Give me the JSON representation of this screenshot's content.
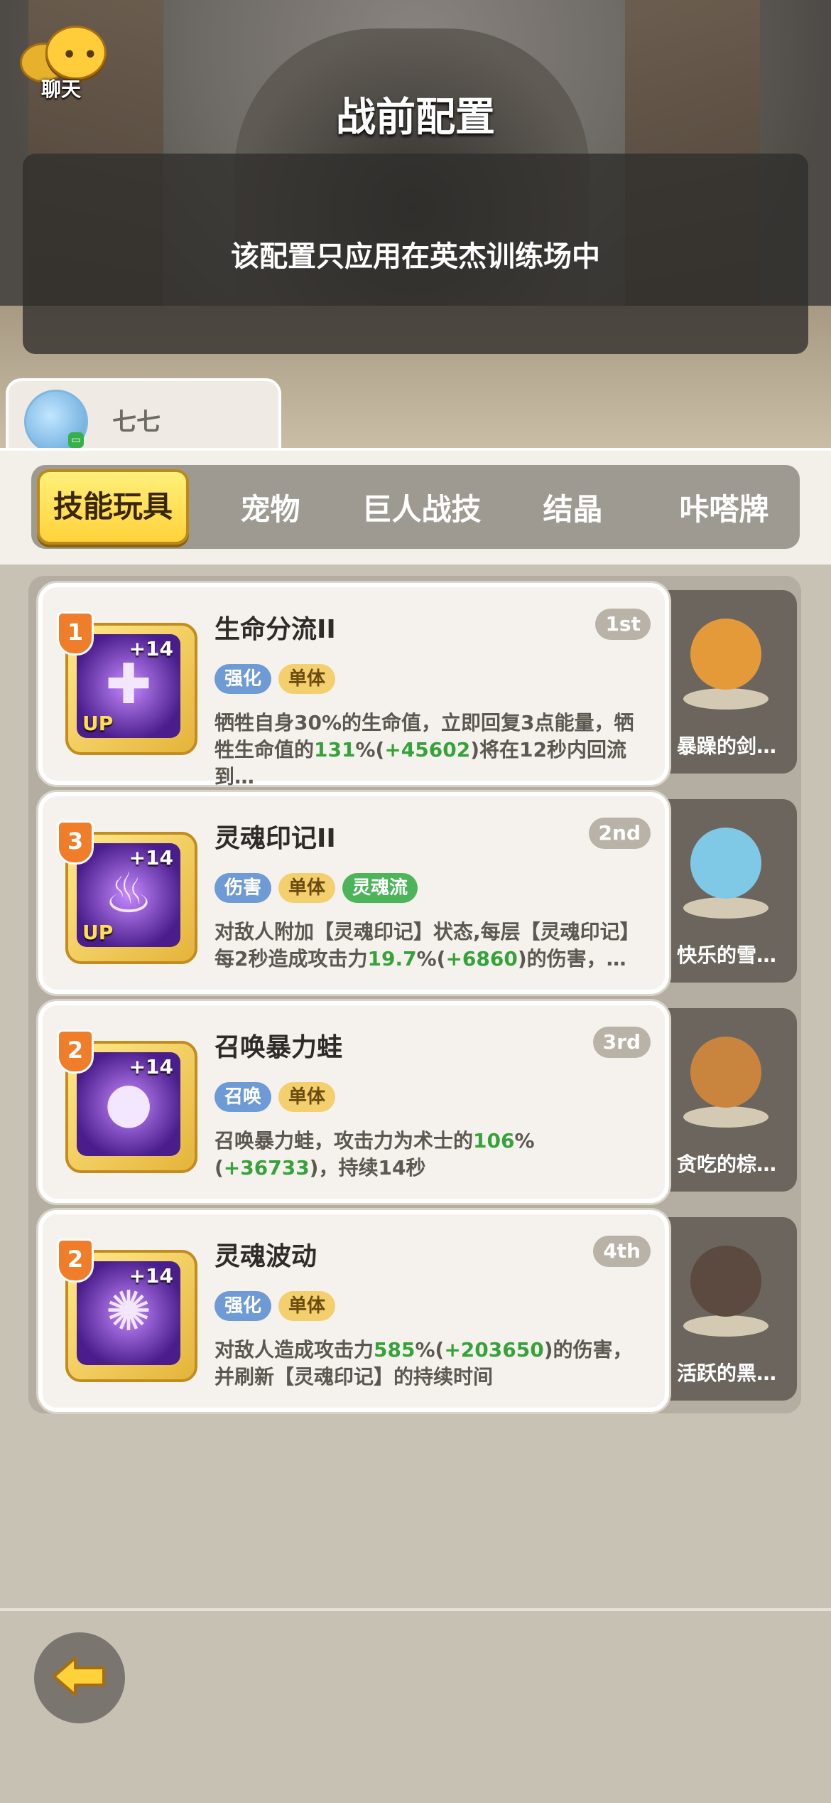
{
  "header": {
    "chat_label": "聊天",
    "title": "战前配置",
    "notice": "该配置只应用在英杰训练场中"
  },
  "player": {
    "name": "七七"
  },
  "tabs": [
    {
      "label": "技能玩具",
      "active": true
    },
    {
      "label": "宠物",
      "active": false
    },
    {
      "label": "巨人战技",
      "active": false
    },
    {
      "label": "结晶",
      "active": false
    },
    {
      "label": "咔嗒牌",
      "active": false
    }
  ],
  "skills": [
    {
      "name": "生命分流II",
      "rank": "1st",
      "level": "1",
      "plus": "+14",
      "up": "UP",
      "glyph": "✚",
      "tags": [
        {
          "text": "强化",
          "color": "blue"
        },
        {
          "text": "单体",
          "color": "yellow"
        }
      ],
      "desc_parts": [
        {
          "text": "牺牲自身30%的生命值，立即回复3点能量，牺牲生命值的",
          "hl": false
        },
        {
          "text": "131",
          "hl": true
        },
        {
          "text": "%(",
          "hl": false
        },
        {
          "text": "+45602",
          "hl": true
        },
        {
          "text": ")将在12秒内回流到…",
          "hl": false
        }
      ],
      "pet": {
        "name": "暴躁的剑…",
        "color": "#e59a3a"
      }
    },
    {
      "name": "灵魂印记II",
      "rank": "2nd",
      "level": "3",
      "plus": "+14",
      "up": "UP",
      "glyph": "♨",
      "tags": [
        {
          "text": "伤害",
          "color": "blue"
        },
        {
          "text": "单体",
          "color": "yellow"
        },
        {
          "text": "灵魂流",
          "color": "green"
        }
      ],
      "desc_parts": [
        {
          "text": "对敌人附加【灵魂印记】状态,每层【灵魂印记】每2秒造成攻击力",
          "hl": false
        },
        {
          "text": "19.7",
          "hl": true
        },
        {
          "text": "%(",
          "hl": false
        },
        {
          "text": "+6860",
          "hl": true
        },
        {
          "text": ")的伤害，…",
          "hl": false
        }
      ],
      "pet": {
        "name": "快乐的雪…",
        "color": "#7fc9e6"
      }
    },
    {
      "name": "召唤暴力蛙",
      "rank": "3rd",
      "level": "2",
      "plus": "+14",
      "up": "",
      "glyph": "●",
      "tags": [
        {
          "text": "召唤",
          "color": "blue"
        },
        {
          "text": "单体",
          "color": "yellow"
        }
      ],
      "desc_parts": [
        {
          "text": "召唤暴力蛙，攻击力为术士的",
          "hl": false
        },
        {
          "text": "106",
          "hl": true
        },
        {
          "text": "%(",
          "hl": false
        },
        {
          "text": "+36733",
          "hl": true
        },
        {
          "text": ")，持续14秒",
          "hl": false
        }
      ],
      "pet": {
        "name": "贪吃的棕…",
        "color": "#c9853e"
      }
    },
    {
      "name": "灵魂波动",
      "rank": "4th",
      "level": "2",
      "plus": "+14",
      "up": "",
      "glyph": "✺",
      "tags": [
        {
          "text": "强化",
          "color": "blue"
        },
        {
          "text": "单体",
          "color": "yellow"
        }
      ],
      "desc_parts": [
        {
          "text": "对敌人造成攻击力",
          "hl": false
        },
        {
          "text": "585",
          "hl": true
        },
        {
          "text": "%(",
          "hl": false
        },
        {
          "text": "+203650",
          "hl": true
        },
        {
          "text": ")的伤害，并刷新【灵魂印记】的持续时间",
          "hl": false
        }
      ],
      "pet": {
        "name": "活跃的黑…",
        "color": "#5c4a40"
      }
    }
  ]
}
